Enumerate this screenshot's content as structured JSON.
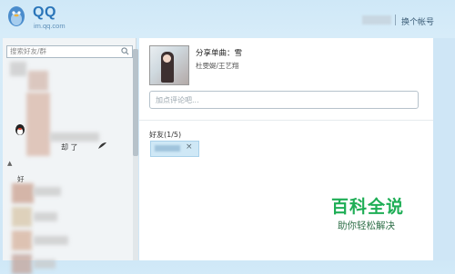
{
  "header": {
    "logo_title": "QQ",
    "logo_subtitle": "im.qq.com",
    "switch_account": "换个帐号"
  },
  "sidebar": {
    "search_placeholder": "搜索好友/群",
    "blurred_text": "却 了",
    "group_label": "好"
  },
  "share": {
    "title": "分享单曲：雪",
    "artist": "杜雯媞/王艺翔"
  },
  "comment": {
    "placeholder": "加点评论吧..."
  },
  "friends": {
    "label": "好友(1/5)",
    "remove_glyph": "×"
  },
  "watermark": {
    "main": "百科全说",
    "sub": "助你轻松解决"
  },
  "colors": {
    "accent": "#2a75b9",
    "background": "#cfe8f7",
    "watermark": "#1fae56"
  }
}
